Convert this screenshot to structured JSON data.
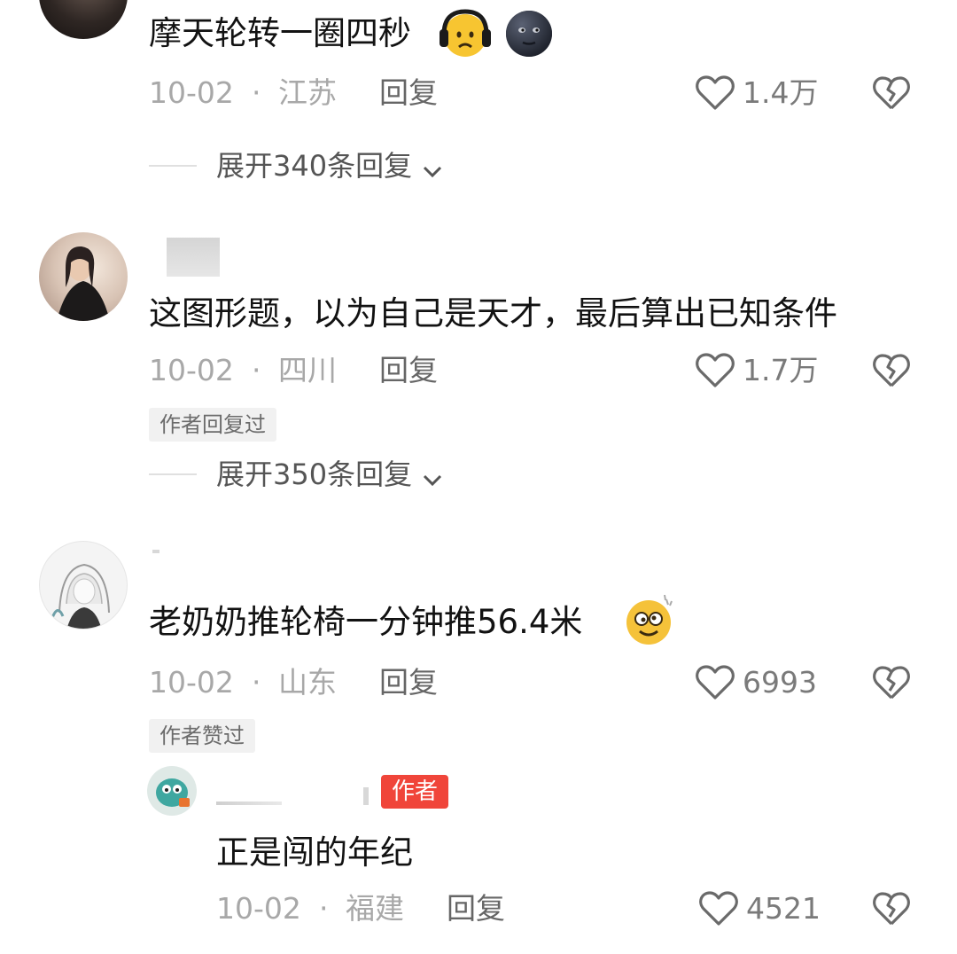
{
  "comments": [
    {
      "text": "摩天轮转一圈四秒",
      "date": "10-02",
      "sep": "·",
      "location": "江苏",
      "reply_label": "回复",
      "likes": "1.4万",
      "emojis": [
        "headphones-face-emoji",
        "dark-moon-face-emoji"
      ],
      "expand_label": "展开340条回复"
    },
    {
      "text": "这图形题，以为自己是天才，最后算出已知条件",
      "date": "10-02",
      "sep": "·",
      "location": "四川",
      "reply_label": "回复",
      "likes": "1.7万",
      "badge": "作者回复过",
      "expand_label": "展开350条回复"
    },
    {
      "text": "老奶奶推轮椅一分钟推56.4米",
      "date": "10-02",
      "sep": "·",
      "location": "山东",
      "reply_label": "回复",
      "likes": "6993",
      "badge": "作者赞过",
      "emojis": [
        "dizzy-face-emoji"
      ]
    }
  ],
  "reply": {
    "author_tag": "作者",
    "text": "正是闯的年纪",
    "date": "10-02",
    "sep": "·",
    "location": "福建",
    "reply_label": "回复",
    "likes": "4521"
  },
  "colors": {
    "author_tag_bg": "#f0453a",
    "meta_gray": "#a8a8a8",
    "text": "#121212"
  },
  "icons": {
    "like": "heart-outline-icon",
    "dislike": "broken-heart-icon",
    "expand": "chevron-down-icon"
  }
}
